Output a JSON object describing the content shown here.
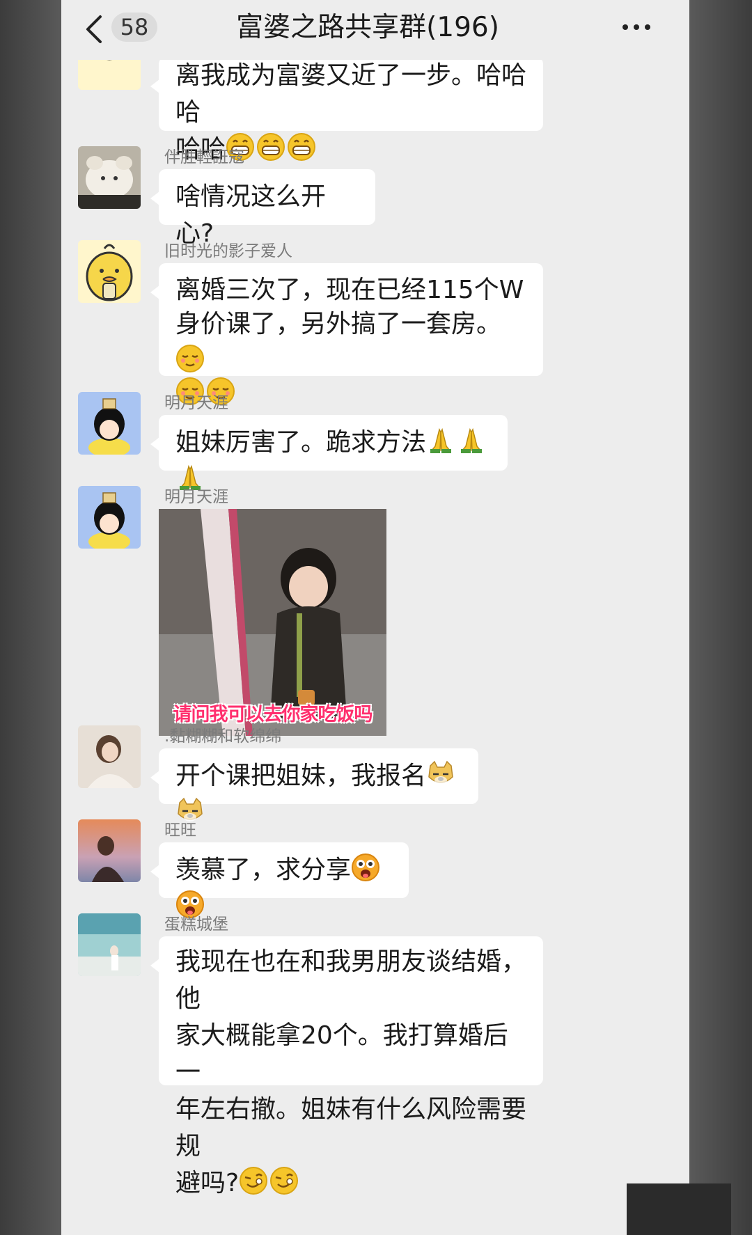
{
  "header": {
    "unread_count": "58",
    "title": "富婆之路共享群(196)"
  },
  "messages": [
    {
      "sender": "",
      "text_lines": [
        "离我成为富婆又近了一步。哈哈哈",
        "哈哈"
      ],
      "emojis": [
        "grin-emoji",
        "grin-emoji",
        "grin-emoji"
      ]
    },
    {
      "sender": "伴胜輕誑寇",
      "text_lines": [
        "啥情况这么开心?"
      ],
      "emojis": []
    },
    {
      "sender": "旧时光的影子爱人",
      "text_lines": [
        "离婚三次了，现在已经115个W",
        "身价课了，另外搞了一套房。"
      ],
      "emojis": [
        "smug-emoji",
        "smug-emoji",
        "smug-emoji"
      ]
    },
    {
      "sender": "明月天涯",
      "text_lines": [
        "姐妹厉害了。跪求方法"
      ],
      "emojis": [
        "pray-emoji",
        "pray-emoji",
        "pray-emoji"
      ]
    },
    {
      "sender": "明月天涯",
      "image_caption": "请问我可以去你家吃饭吗"
    },
    {
      "sender": ".黏糊糊和软绵绵",
      "text_lines": [
        "开个课把姐妹，我报名"
      ],
      "emojis": [
        "doge-emoji",
        "doge-emoji"
      ]
    },
    {
      "sender": "旺旺",
      "text_lines": [
        "羡慕了，求分享"
      ],
      "emojis": [
        "starstruck-emoji",
        "starstruck-emoji"
      ]
    },
    {
      "sender": "蛋糕城堡",
      "text_lines": [
        "我现在也在和我男朋友谈结婚，他",
        "家大概能拿20个。我打算婚后一",
        "年左右撤。姐妹有什么风险需要规",
        "避吗?"
      ],
      "emojis": [
        "wink-emoji",
        "wink-emoji"
      ]
    }
  ],
  "colors": {
    "chat_background": "#ededed",
    "bubble": "#ffffff",
    "emoji_yellow": "#f6c52a",
    "caption_pink": "#ff2f6e"
  }
}
